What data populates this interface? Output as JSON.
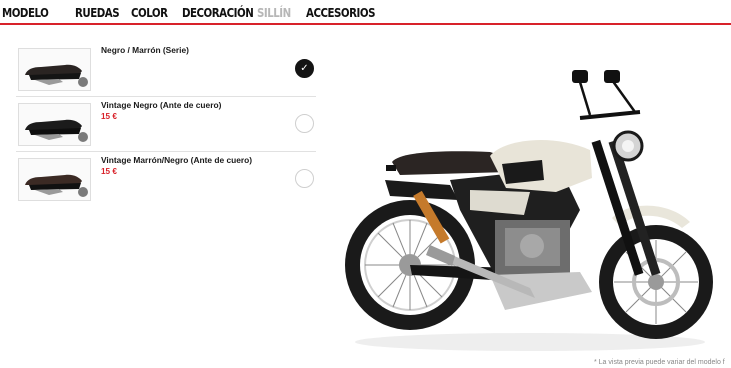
{
  "nav": {
    "items": [
      {
        "label": "MODELO"
      },
      {
        "label": "RUEDAS"
      },
      {
        "label": "COLOR"
      },
      {
        "label": "DECORACIÓN"
      },
      {
        "label": "SILLÍN"
      },
      {
        "label": "ACCESORIOS"
      }
    ],
    "active": "SILLÍN",
    "accent": "#d8222a"
  },
  "options": [
    {
      "name": "Negro / Marrón (Serie)",
      "price": "",
      "selected": true
    },
    {
      "name": "Vintage Negro (Ante de cuero)",
      "price": "15 €",
      "selected": false
    },
    {
      "name": "Vintage Marrón/Negro (Ante de cuero)",
      "price": "15 €",
      "selected": false
    }
  ],
  "check_symbol": "✓",
  "preview": {
    "disclaimer": "* La vista previa puede variar del modelo f",
    "icon": "motorcycle-preview"
  }
}
